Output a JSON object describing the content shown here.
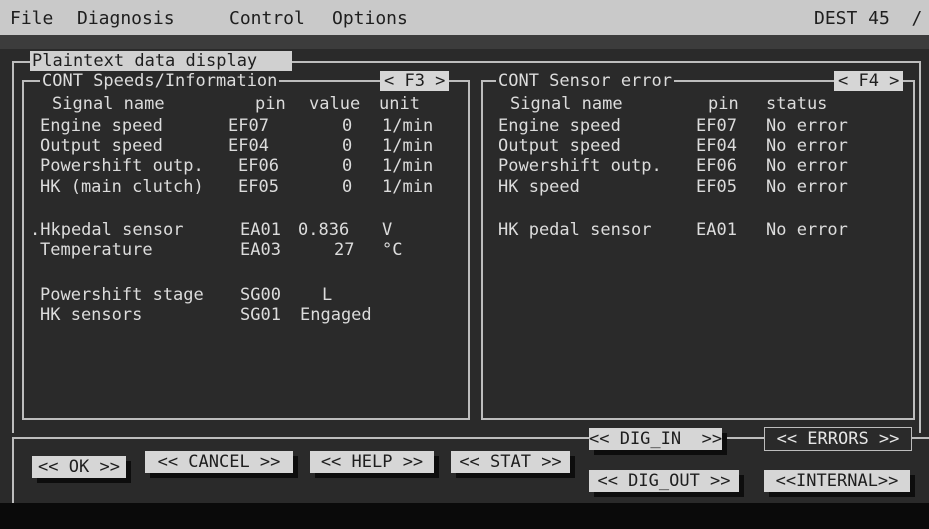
{
  "menubar": {
    "items": [
      "File",
      "Diagnosis",
      "Control",
      "Options"
    ],
    "right_label": "DEST 45  /"
  },
  "window_title": "Plaintext data display",
  "left_panel": {
    "title": "CONT Speeds/Information",
    "fkey": "< F3 >",
    "headers": {
      "signal": "Signal name",
      "pin": "pin",
      "value": "value",
      "unit": "unit"
    },
    "rows": [
      {
        "signal": "Engine speed",
        "pin": "EF07",
        "value": "0",
        "unit": "1/min"
      },
      {
        "signal": "Output speed",
        "pin": "EF04",
        "value": "0",
        "unit": "1/min"
      },
      {
        "signal": "Powershift outp.",
        "pin": "EF06",
        "value": "0",
        "unit": "1/min"
      },
      {
        "signal": "HK (main clutch)",
        "pin": "EF05",
        "value": "0",
        "unit": "1/min"
      }
    ],
    "rows2": [
      {
        "signal": ".Hkpedal sensor",
        "pin": "EA01",
        "value": "0.836",
        "unit": "V"
      },
      {
        "signal": "Temperature",
        "pin": "EA03",
        "value": "27",
        "unit": "°C"
      }
    ],
    "rows3": [
      {
        "signal": "Powershift stage",
        "pin": "SG00",
        "value": "L"
      },
      {
        "signal": "HK sensors",
        "pin": "SG01",
        "value": "Engaged"
      }
    ]
  },
  "right_panel": {
    "title": "CONT Sensor error",
    "fkey": "< F4 >",
    "headers": {
      "signal": "Signal name",
      "pin": "pin",
      "status": "status"
    },
    "rows": [
      {
        "signal": "Engine speed",
        "pin": "EF07",
        "status": "No error"
      },
      {
        "signal": "Output speed",
        "pin": "EF04",
        "status": "No error"
      },
      {
        "signal": "Powershift outp.",
        "pin": "EF06",
        "status": "No error"
      },
      {
        "signal": "HK speed",
        "pin": "EF05",
        "status": "No error"
      },
      {
        "signal": "HK pedal sensor",
        "pin": "EA01",
        "status": "No error"
      }
    ]
  },
  "buttons": {
    "ok": "<< OK >>",
    "cancel": "<< CANCEL >>",
    "help": "<< HELP >>",
    "stat": "<< STAT >>",
    "dig_in": "<< DIG_IN  >>",
    "errors": "<< ERRORS >>",
    "dig_out": "<< DIG_OUT >>",
    "internal": "<<INTERNAL>>"
  }
}
